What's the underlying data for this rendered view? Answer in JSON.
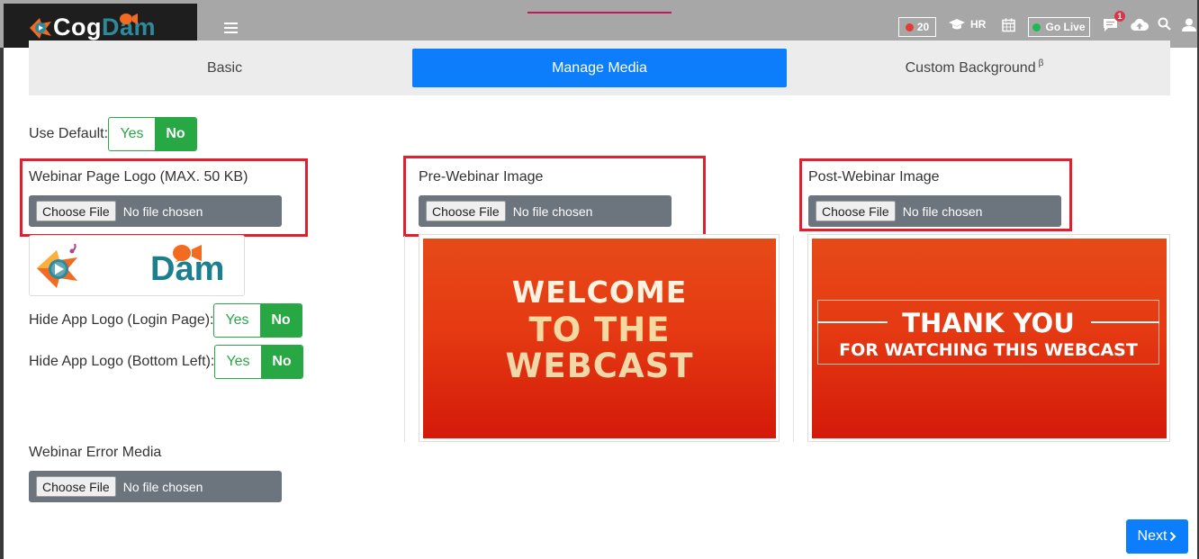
{
  "brand": {
    "part1": "Cog",
    "part2": "Dam"
  },
  "navbar": {
    "rec_count": "20",
    "hr_label": "HR",
    "golive_label": "Go Live",
    "chat_badge": "1",
    "icons": [
      "menu-icon",
      "record-icon",
      "graduation-cap-icon",
      "calendar-icon",
      "chat-icon",
      "cloud-upload-icon",
      "search-icon",
      "user-icon"
    ]
  },
  "tabs": [
    {
      "label": "Basic",
      "active": false
    },
    {
      "label": "Manage Media",
      "active": true
    },
    {
      "label": "Custom Background",
      "active": false,
      "superscript": "β"
    }
  ],
  "use_default": {
    "label": "Use Default:",
    "yes": "Yes",
    "no": "No",
    "selected": "No"
  },
  "webinar_logo": {
    "label": "Webinar Page Logo (MAX. 50 KB)",
    "preview_text": "Dam"
  },
  "pre_image": {
    "label": "Pre-Webinar Image",
    "line1": "WELCOME",
    "line2": "TO THE",
    "line3": "WEBCAST"
  },
  "post_image": {
    "label": "Post-Webinar Image",
    "line1": "THANK YOU",
    "line2": "FOR WATCHING THIS WEBCAST"
  },
  "hide_login_logo": {
    "label": "Hide App Logo (Login Page):",
    "yes": "Yes",
    "no": "No",
    "selected": "No"
  },
  "hide_bottom_logo": {
    "label": "Hide App Logo (Bottom Left):",
    "yes": "Yes",
    "no": "No",
    "selected": "No"
  },
  "error_media": {
    "label": "Webinar Error Media"
  },
  "file_input": {
    "button": "Choose File",
    "status": "No file chosen"
  },
  "next_label": "Next",
  "colors": {
    "primary": "#0d7efb",
    "success": "#28a745",
    "highlight": "#e0202e",
    "navbar": "#a7a7a7"
  }
}
